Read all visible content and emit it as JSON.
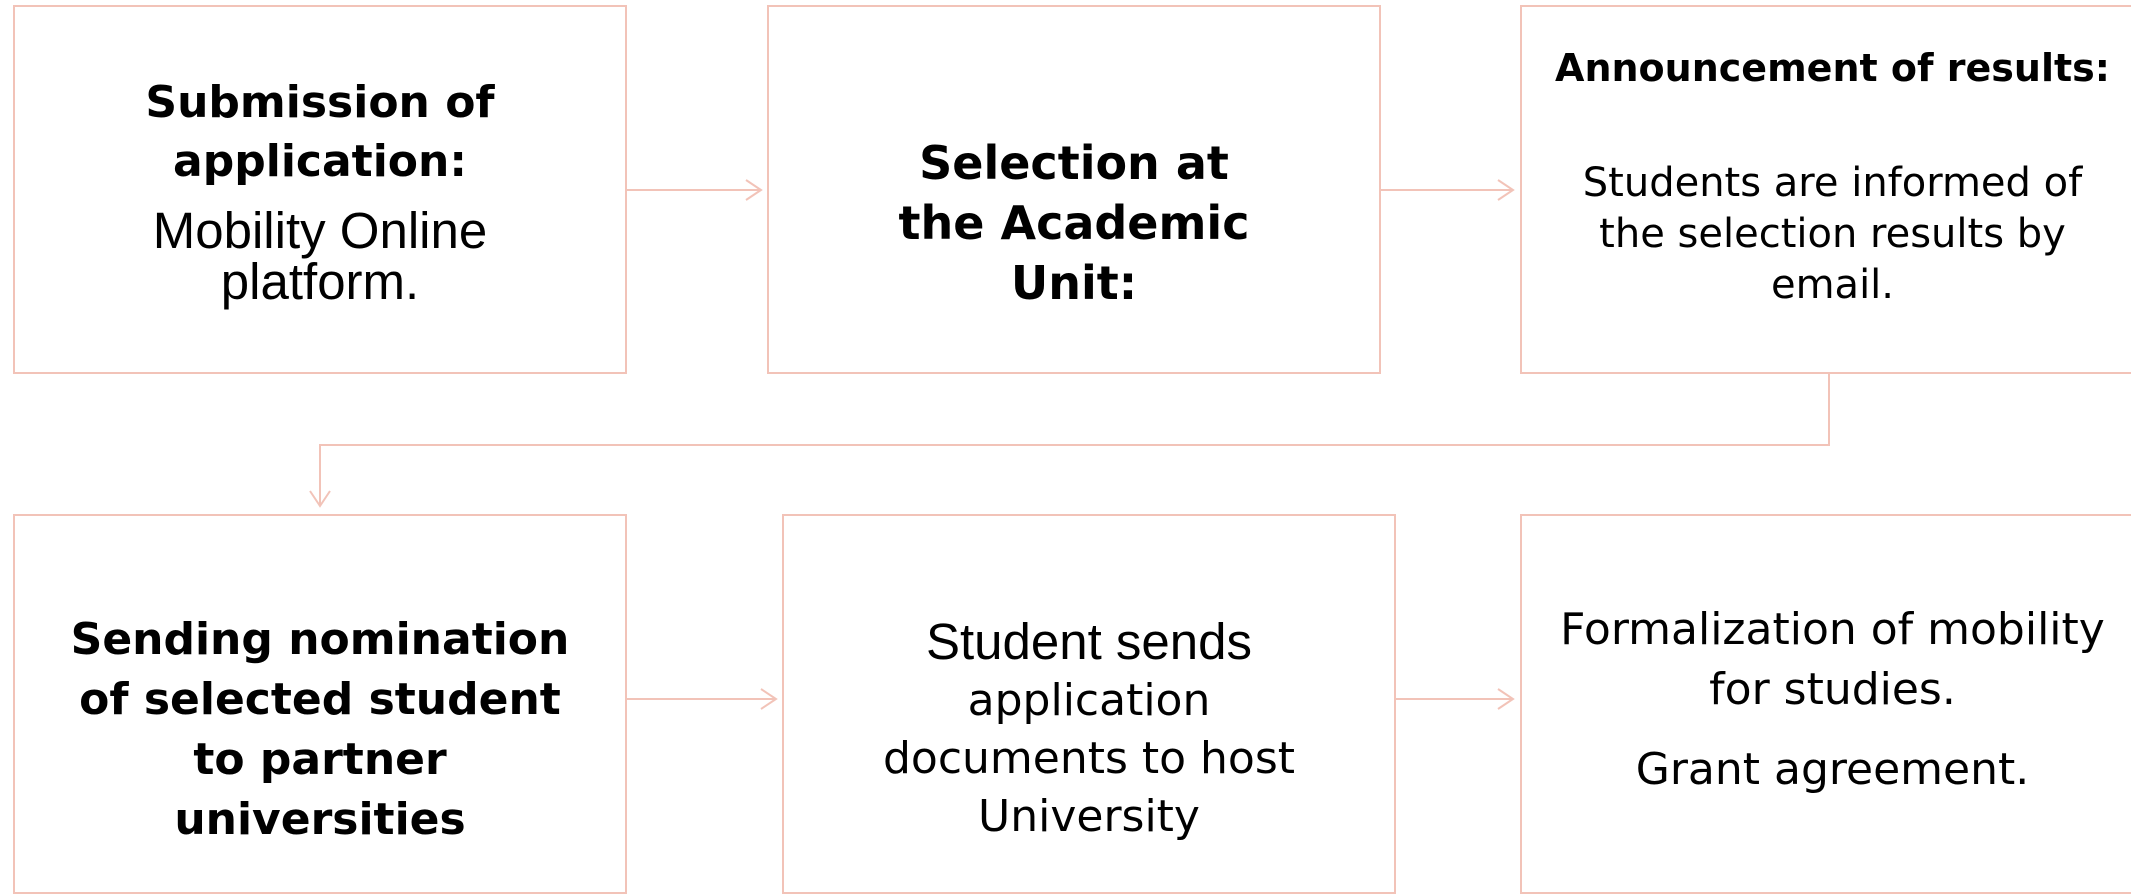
{
  "colors": {
    "box_border": "#f2c3b8",
    "connector": "#f2c3b8",
    "text": "#000000",
    "background": "#ffffff"
  },
  "steps": [
    {
      "id": "submission",
      "heading": "Submission of application:",
      "body": "Mobility Online platform."
    },
    {
      "id": "selection",
      "heading": "Selection at the Academic Unit:"
    },
    {
      "id": "announcement",
      "heading": "Announcement of results:",
      "body": "Students are informed of the selection results by email."
    },
    {
      "id": "nomination",
      "heading": "Sending nomination of selected student to partner universities"
    },
    {
      "id": "documents",
      "body_lead": "Student sends",
      "body": "application documents to host University"
    },
    {
      "id": "formalization",
      "body": "Formalization of mobility for studies.",
      "body_extra": "Grant agreement."
    }
  ],
  "connections": [
    {
      "from": "submission",
      "to": "selection"
    },
    {
      "from": "selection",
      "to": "announcement"
    },
    {
      "from": "announcement",
      "to": "nomination"
    },
    {
      "from": "nomination",
      "to": "documents"
    },
    {
      "from": "documents",
      "to": "formalization"
    }
  ]
}
